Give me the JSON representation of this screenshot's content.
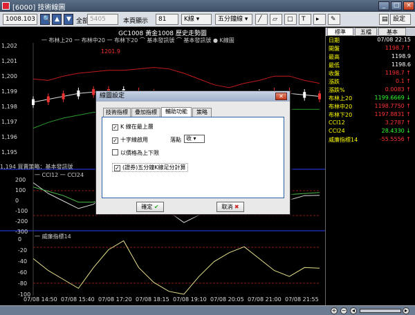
{
  "window": {
    "title": "[6000] 技術線圖",
    "help_label": "?"
  },
  "toolbar": {
    "symbol_value": "1008.103",
    "all_label": "全部",
    "code_placeholder": "5405",
    "show_label": "本頁顯示",
    "show_value": "81",
    "kline_label": "K線",
    "period_label": "五分鐘線",
    "settings_label": "設定"
  },
  "chart": {
    "title": "GC1008 黃金1008 歷史走勢圖",
    "legend": "一 布林上20    一 布林中20    一 布林下20    ⌒ 基本發訊號  ⌒ 基本發訊號  ● K線圖",
    "high_marker": "1201.9",
    "strategy_label": "1,194 買賣策略：基本發訊號",
    "cci_label": "一 CCI12   一 CCI24",
    "williams_label": "一 威廉指標14",
    "price_ticks": [
      "1,202",
      "1,201",
      "1,200",
      "1,199",
      "1,198",
      "1,197",
      "1,196",
      "1,195"
    ],
    "cci_ticks": [
      "200",
      "100",
      "0",
      "-100",
      "-200",
      "-300"
    ],
    "wr_ticks": [
      "0",
      "-20",
      "-40",
      "-60",
      "-80",
      "-100"
    ],
    "time_ticks": [
      "07/08 14:50",
      "07/08 15:40",
      "07/08 17:20",
      "07/08 18:15",
      "07/08 19:10",
      "07/08 20:05",
      "07/08 21:00",
      "07/08 21:55"
    ]
  },
  "side": {
    "tabs": [
      "標準",
      "五檔",
      "基本"
    ],
    "quotes": [
      {
        "k": "日期",
        "v": "07/08 22:15",
        "c": "#ffffff"
      },
      {
        "k": "開盤",
        "v": "1198.7 ↑",
        "c": "#ff3333"
      },
      {
        "k": "最高",
        "v": "1198.9",
        "c": "#ffffff"
      },
      {
        "k": "最低",
        "v": "1198.6",
        "c": "#ffffff"
      },
      {
        "k": "收盤",
        "v": "1198.7 ↑",
        "c": "#ff3333"
      },
      {
        "k": "漲跌",
        "v": "0.1 ↑",
        "c": "#ff3333"
      },
      {
        "k": "漲跌%",
        "v": "0.0083 ↑",
        "c": "#ff3333"
      },
      {
        "k": "布林上20",
        "v": "1199.6669 ↓",
        "c": "#33ff33"
      },
      {
        "k": "布林中20",
        "v": "1198.7750 ↑",
        "c": "#ff3333"
      },
      {
        "k": "布林下20",
        "v": "1197.8831 ↑",
        "c": "#ff3333"
      },
      {
        "k": "CCI12",
        "v": "3.2787 ↑",
        "c": "#ff3333"
      },
      {
        "k": "CCI24",
        "v": "28.4330 ↓",
        "c": "#33ff33"
      },
      {
        "k": "威廉指標14",
        "v": "-55.5556 ↑",
        "c": "#ff3333"
      }
    ]
  },
  "dialog": {
    "title": "線圖設定",
    "close_label": "✕",
    "tabs": [
      "技術指標",
      "疊加指標",
      "輔助功能",
      "策略"
    ],
    "opt1": "K 線在最上層",
    "opt2": "十字線啟用",
    "price_point_label": "落點",
    "price_point_value": "收",
    "opt3": "以價格為上下限",
    "opt4": "(證券)五分鐘K線足分計算",
    "ok_label": "確定",
    "cancel_label": "取消"
  },
  "chart_data": {
    "type": "line",
    "price": {
      "bollinger_upper": [
        1200.0,
        1199.9,
        1200.2,
        1200.4,
        1200.5,
        1200.6,
        1200.6,
        1200.7,
        1200.8,
        1200.7,
        1200.4,
        1200.0,
        1199.6,
        1199.4,
        1199.7,
        1199.9,
        1200.2,
        1200.2,
        1199.9,
        1199.7
      ],
      "bollinger_mid": [
        1198.4,
        1198.6,
        1198.8,
        1199.0,
        1199.1,
        1199.1,
        1199.1,
        1199.0,
        1198.9,
        1198.8,
        1198.7,
        1198.6,
        1198.5,
        1198.6,
        1198.8,
        1198.9,
        1199.0,
        1199.0,
        1198.9,
        1198.8
      ],
      "bollinger_lower": [
        1196.6,
        1197.0,
        1197.3,
        1197.5,
        1197.7,
        1197.7,
        1197.6,
        1197.4,
        1197.2,
        1197.2,
        1197.3,
        1197.5,
        1197.7,
        1197.8,
        1197.9,
        1198.0,
        1198.0,
        1197.9,
        1197.9,
        1197.9
      ]
    },
    "cci": {
      "cci12": [
        120,
        20,
        -50,
        -120,
        -80,
        40,
        150,
        80,
        -20,
        -150,
        -250,
        -180,
        -60,
        40,
        120,
        90,
        10,
        -40,
        0,
        3
      ],
      "cci24": [
        80,
        40,
        0,
        -60,
        -60,
        0,
        80,
        60,
        10,
        -80,
        -160,
        -140,
        -60,
        0,
        60,
        60,
        30,
        10,
        20,
        28
      ]
    },
    "williams14": [
      -40,
      -60,
      -75,
      -90,
      -55,
      -25,
      -10,
      -55,
      -80,
      -95,
      -100,
      -70,
      -45,
      -30,
      -20,
      -40,
      -60,
      -70,
      -55,
      -56
    ],
    "ylim_price": [
      1194,
      1202.5
    ],
    "ylim_cci": [
      -300,
      200
    ],
    "ylim_wr": [
      -100,
      0
    ]
  }
}
